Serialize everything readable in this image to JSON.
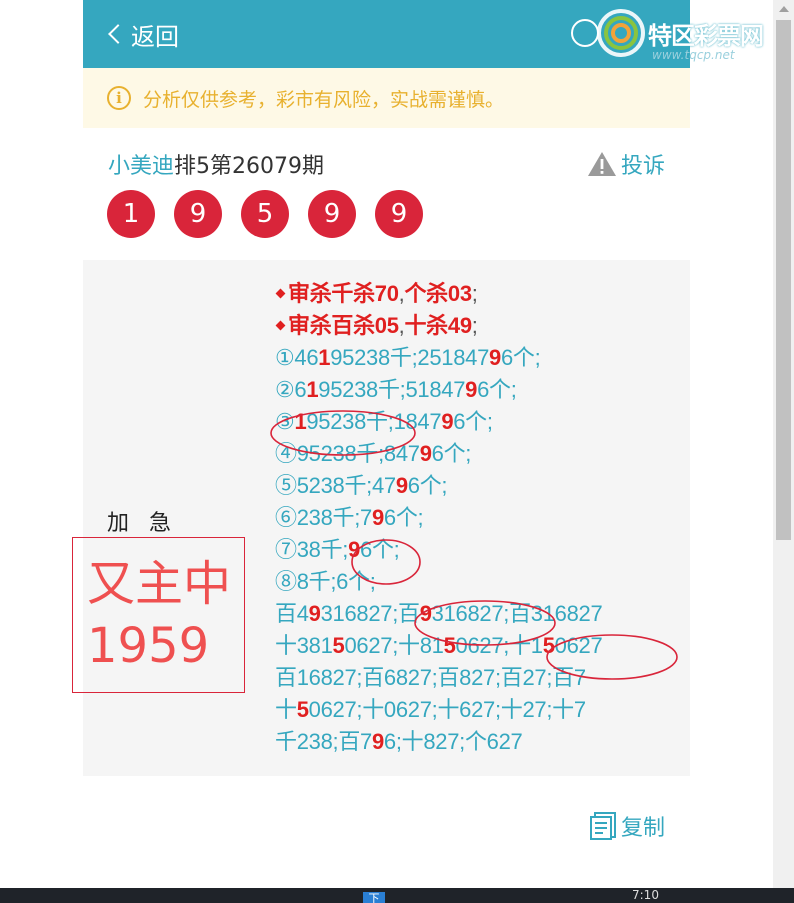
{
  "header": {
    "back_label": "返回"
  },
  "notice": {
    "text": "分析仅供参考，彩市有风险，实战需谨慎。"
  },
  "post": {
    "author": "小美迪",
    "period": "排5第26079期",
    "report_label": "投诉"
  },
  "balls": [
    "1",
    "9",
    "5",
    "9",
    "9"
  ],
  "side": {
    "urgent_1": "加",
    "urgent_2": "急",
    "box_line1": "又主中",
    "box_line2": "1959"
  },
  "lines": [
    {
      "type": "head",
      "segs": [
        {
          "t": "审杀千杀70"
        },
        {
          "t": ",",
          "d": true
        },
        {
          "t": "个杀03"
        },
        {
          "t": ";",
          "d": true
        }
      ]
    },
    {
      "type": "head",
      "segs": [
        {
          "t": "审杀百杀05"
        },
        {
          "t": ",",
          "d": true
        },
        {
          "t": "十杀49"
        },
        {
          "t": ";",
          "d": true
        }
      ]
    },
    {
      "type": "body",
      "segs": [
        {
          "t": "①46"
        },
        {
          "t": "1",
          "r": true
        },
        {
          "t": "95238千;251847"
        },
        {
          "t": "9",
          "r": true
        },
        {
          "t": "6个;"
        }
      ]
    },
    {
      "type": "body",
      "segs": [
        {
          "t": "②6"
        },
        {
          "t": "1",
          "r": true
        },
        {
          "t": "95238千;51847"
        },
        {
          "t": "9",
          "r": true
        },
        {
          "t": "6个;"
        }
      ]
    },
    {
      "type": "body",
      "segs": [
        {
          "t": "③"
        },
        {
          "t": "1",
          "r": true
        },
        {
          "t": "95238千;1847"
        },
        {
          "t": "9",
          "r": true
        },
        {
          "t": "6个;"
        }
      ]
    },
    {
      "type": "body",
      "segs": [
        {
          "t": "④95238千;847"
        },
        {
          "t": "9",
          "r": true
        },
        {
          "t": "6个;"
        }
      ]
    },
    {
      "type": "body",
      "segs": [
        {
          "t": "⑤5238千;47"
        },
        {
          "t": "9",
          "r": true
        },
        {
          "t": "6个;"
        }
      ]
    },
    {
      "type": "body",
      "segs": [
        {
          "t": "⑥238千;7"
        },
        {
          "t": "9",
          "r": true
        },
        {
          "t": "6个;"
        }
      ]
    },
    {
      "type": "body",
      "segs": [
        {
          "t": "⑦38千;"
        },
        {
          "t": "9",
          "r": true
        },
        {
          "t": "6个;"
        }
      ]
    },
    {
      "type": "body",
      "segs": [
        {
          "t": "⑧8千;6个;"
        }
      ]
    },
    {
      "type": "body",
      "segs": [
        {
          "t": "百4"
        },
        {
          "t": "9",
          "r": true
        },
        {
          "t": "316827;百"
        },
        {
          "t": "9",
          "r": true
        },
        {
          "t": "316827;百316827"
        }
      ]
    },
    {
      "type": "body",
      "segs": [
        {
          "t": "十381"
        },
        {
          "t": "5",
          "r": true
        },
        {
          "t": "0627;十81"
        },
        {
          "t": "5",
          "r": true
        },
        {
          "t": "0627;十1"
        },
        {
          "t": "5",
          "r": true
        },
        {
          "t": "0627"
        }
      ]
    },
    {
      "type": "body",
      "segs": [
        {
          "t": "百16827;百6827;百827;百27;百7"
        }
      ]
    },
    {
      "type": "body",
      "segs": [
        {
          "t": "十"
        },
        {
          "t": "5",
          "r": true
        },
        {
          "t": "0627;十0627;十627;十27;十7"
        }
      ]
    },
    {
      "type": "body",
      "segs": [
        {
          "t": "千238;百7"
        },
        {
          "t": "9",
          "r": true
        },
        {
          "t": "6;十827;个627"
        }
      ]
    }
  ],
  "copy": {
    "label": "复制"
  },
  "watermark": {
    "name": "特区彩票网",
    "url": "www.tqcp.net"
  },
  "taskbar": {
    "ime": "下",
    "clock": "7:10"
  },
  "colors": {
    "accent": "#35a7bf",
    "ball": "#d9253a",
    "notice": "#e8b12f",
    "highlight": "#e02020"
  }
}
